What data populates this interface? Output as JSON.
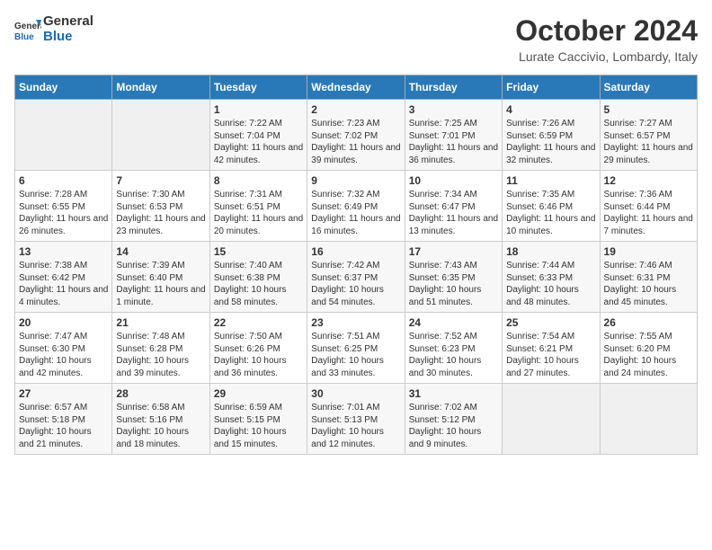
{
  "header": {
    "logo_general": "General",
    "logo_blue": "Blue",
    "month_title": "October 2024",
    "location": "Lurate Caccivio, Lombardy, Italy"
  },
  "weekdays": [
    "Sunday",
    "Monday",
    "Tuesday",
    "Wednesday",
    "Thursday",
    "Friday",
    "Saturday"
  ],
  "weeks": [
    [
      {
        "day": "",
        "empty": true
      },
      {
        "day": "",
        "empty": true
      },
      {
        "day": "1",
        "sunrise": "7:22 AM",
        "sunset": "7:04 PM",
        "daylight": "11 hours and 42 minutes."
      },
      {
        "day": "2",
        "sunrise": "7:23 AM",
        "sunset": "7:02 PM",
        "daylight": "11 hours and 39 minutes."
      },
      {
        "day": "3",
        "sunrise": "7:25 AM",
        "sunset": "7:01 PM",
        "daylight": "11 hours and 36 minutes."
      },
      {
        "day": "4",
        "sunrise": "7:26 AM",
        "sunset": "6:59 PM",
        "daylight": "11 hours and 32 minutes."
      },
      {
        "day": "5",
        "sunrise": "7:27 AM",
        "sunset": "6:57 PM",
        "daylight": "11 hours and 29 minutes."
      }
    ],
    [
      {
        "day": "6",
        "sunrise": "7:28 AM",
        "sunset": "6:55 PM",
        "daylight": "11 hours and 26 minutes."
      },
      {
        "day": "7",
        "sunrise": "7:30 AM",
        "sunset": "6:53 PM",
        "daylight": "11 hours and 23 minutes."
      },
      {
        "day": "8",
        "sunrise": "7:31 AM",
        "sunset": "6:51 PM",
        "daylight": "11 hours and 20 minutes."
      },
      {
        "day": "9",
        "sunrise": "7:32 AM",
        "sunset": "6:49 PM",
        "daylight": "11 hours and 16 minutes."
      },
      {
        "day": "10",
        "sunrise": "7:34 AM",
        "sunset": "6:47 PM",
        "daylight": "11 hours and 13 minutes."
      },
      {
        "day": "11",
        "sunrise": "7:35 AM",
        "sunset": "6:46 PM",
        "daylight": "11 hours and 10 minutes."
      },
      {
        "day": "12",
        "sunrise": "7:36 AM",
        "sunset": "6:44 PM",
        "daylight": "11 hours and 7 minutes."
      }
    ],
    [
      {
        "day": "13",
        "sunrise": "7:38 AM",
        "sunset": "6:42 PM",
        "daylight": "11 hours and 4 minutes."
      },
      {
        "day": "14",
        "sunrise": "7:39 AM",
        "sunset": "6:40 PM",
        "daylight": "11 hours and 1 minute."
      },
      {
        "day": "15",
        "sunrise": "7:40 AM",
        "sunset": "6:38 PM",
        "daylight": "10 hours and 58 minutes."
      },
      {
        "day": "16",
        "sunrise": "7:42 AM",
        "sunset": "6:37 PM",
        "daylight": "10 hours and 54 minutes."
      },
      {
        "day": "17",
        "sunrise": "7:43 AM",
        "sunset": "6:35 PM",
        "daylight": "10 hours and 51 minutes."
      },
      {
        "day": "18",
        "sunrise": "7:44 AM",
        "sunset": "6:33 PM",
        "daylight": "10 hours and 48 minutes."
      },
      {
        "day": "19",
        "sunrise": "7:46 AM",
        "sunset": "6:31 PM",
        "daylight": "10 hours and 45 minutes."
      }
    ],
    [
      {
        "day": "20",
        "sunrise": "7:47 AM",
        "sunset": "6:30 PM",
        "daylight": "10 hours and 42 minutes."
      },
      {
        "day": "21",
        "sunrise": "7:48 AM",
        "sunset": "6:28 PM",
        "daylight": "10 hours and 39 minutes."
      },
      {
        "day": "22",
        "sunrise": "7:50 AM",
        "sunset": "6:26 PM",
        "daylight": "10 hours and 36 minutes."
      },
      {
        "day": "23",
        "sunrise": "7:51 AM",
        "sunset": "6:25 PM",
        "daylight": "10 hours and 33 minutes."
      },
      {
        "day": "24",
        "sunrise": "7:52 AM",
        "sunset": "6:23 PM",
        "daylight": "10 hours and 30 minutes."
      },
      {
        "day": "25",
        "sunrise": "7:54 AM",
        "sunset": "6:21 PM",
        "daylight": "10 hours and 27 minutes."
      },
      {
        "day": "26",
        "sunrise": "7:55 AM",
        "sunset": "6:20 PM",
        "daylight": "10 hours and 24 minutes."
      }
    ],
    [
      {
        "day": "27",
        "sunrise": "6:57 AM",
        "sunset": "5:18 PM",
        "daylight": "10 hours and 21 minutes."
      },
      {
        "day": "28",
        "sunrise": "6:58 AM",
        "sunset": "5:16 PM",
        "daylight": "10 hours and 18 minutes."
      },
      {
        "day": "29",
        "sunrise": "6:59 AM",
        "sunset": "5:15 PM",
        "daylight": "10 hours and 15 minutes."
      },
      {
        "day": "30",
        "sunrise": "7:01 AM",
        "sunset": "5:13 PM",
        "daylight": "10 hours and 12 minutes."
      },
      {
        "day": "31",
        "sunrise": "7:02 AM",
        "sunset": "5:12 PM",
        "daylight": "10 hours and 9 minutes."
      },
      {
        "day": "",
        "empty": true
      },
      {
        "day": "",
        "empty": true
      }
    ]
  ]
}
